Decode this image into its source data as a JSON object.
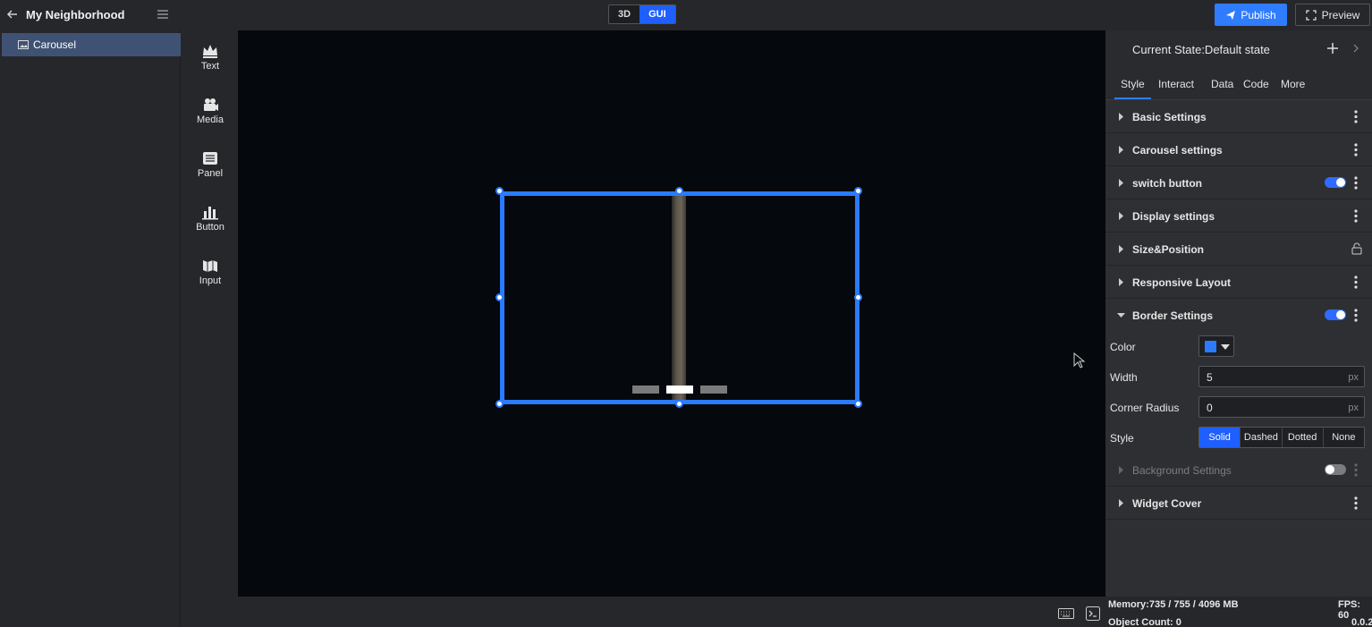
{
  "topbar": {
    "project_title": "My Neighborhood",
    "mode_3d": "3D",
    "mode_gui": "GUI",
    "publish_label": "Publish",
    "preview_label": "Preview"
  },
  "layers": {
    "items": [
      {
        "label": "Carousel",
        "selected": true
      }
    ]
  },
  "toolbox": {
    "items": [
      {
        "label": "Text",
        "icon": "crown-icon"
      },
      {
        "label": "Media",
        "icon": "media-icon"
      },
      {
        "label": "Panel",
        "icon": "panel-icon"
      },
      {
        "label": "Button",
        "icon": "button-icon"
      },
      {
        "label": "Input",
        "icon": "input-icon"
      }
    ]
  },
  "props": {
    "current_state": "Current State:Default state",
    "tabs": [
      "Style",
      "Interact",
      "Data",
      "Code",
      "More"
    ],
    "active_tab": "Style",
    "sections": [
      {
        "title": "Basic Settings"
      },
      {
        "title": "Carousel settings"
      },
      {
        "title": "switch button",
        "toggle": "on"
      },
      {
        "title": "Display settings"
      },
      {
        "title": "Size&Position",
        "locked": true
      },
      {
        "title": "Responsive Layout"
      },
      {
        "title": "Border Settings",
        "toggle": "on",
        "expanded": true
      },
      {
        "title": "Background Settings",
        "toggle": "off",
        "disabled": true
      },
      {
        "title": "Widget Cover"
      }
    ],
    "border": {
      "color_label": "Color",
      "color": "#2a7bff",
      "width_label": "Width",
      "width_value": "5",
      "width_unit": "px",
      "radius_label": "Corner Radius",
      "radius_value": "0",
      "radius_unit": "px",
      "style_label": "Style",
      "style_options": [
        "Solid",
        "Dashed",
        "Dotted",
        "None"
      ],
      "style_selected": "Solid"
    }
  },
  "status": {
    "memory": "Memory:735 / 755 / 4096 MB",
    "object_count": "Object Count: 0",
    "fps": "FPS: 60",
    "frame_time": "0.0.2"
  },
  "colors": {
    "accent": "#2f7cff",
    "selection_border": "#2a7bff",
    "canvas_bg": "#05080c",
    "panel_bg": "#2e2f33"
  }
}
